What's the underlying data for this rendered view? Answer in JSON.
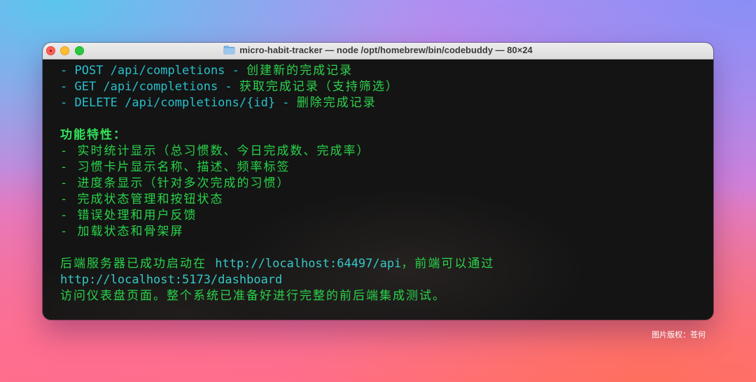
{
  "window": {
    "title": "micro-habit-tracker — node /opt/homebrew/bin/codebuddy — 80×24",
    "title_icon": "folder-icon"
  },
  "terminal": {
    "api_lines": [
      {
        "bullet": "- ",
        "path": "POST /api/completions - ",
        "desc": "创建新的完成记录"
      },
      {
        "bullet": "- ",
        "path": "GET /api/completions - ",
        "desc": "获取完成记录（支持筛选）"
      },
      {
        "bullet": "- ",
        "path": "DELETE /api/completions/{id} - ",
        "desc": "删除完成记录"
      }
    ],
    "features_heading": "功能特性：",
    "features": [
      "- 实时统计显示（总习惯数、今日完成数、完成率）",
      "- 习惯卡片显示名称、描述、频率标签",
      "- 进度条显示（针对多次完成的习惯）",
      "- 完成状态管理和按钮状态",
      "- 错误处理和用户反馈",
      "- 加载状态和骨架屏"
    ],
    "summary_part1": "后端服务器已成功启动在 ",
    "summary_url1": "http://localhost:64497/api",
    "summary_part2": "，前端可以通过",
    "summary_url2": "http://localhost:5173/dashboard",
    "summary_part3": "访问仪表盘页面。整个系统已准备好进行完整的前后端集成测试。"
  },
  "credit": "图片版权：苍何",
  "colors": {
    "terminal_bg": "#141414",
    "text_green": "#29d34a",
    "text_cyan": "#27c0cc"
  }
}
